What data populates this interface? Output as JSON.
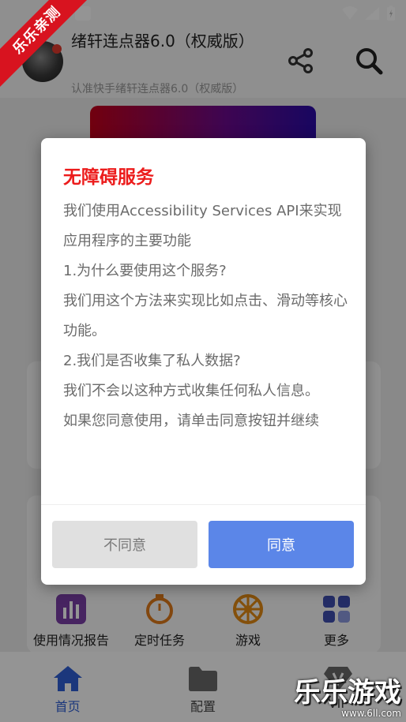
{
  "header": {
    "title": "绪轩连点器6.0（权威版）",
    "subtitle": "认准快手绪轩连点器6.0（权威版）"
  },
  "shortcuts": [
    {
      "label": "使用情况报告",
      "icon": "bar-chart-icon",
      "color": "#7b3fa8"
    },
    {
      "label": "定时任务",
      "icon": "stopwatch-icon",
      "color": "#e07a1a"
    },
    {
      "label": "游戏",
      "icon": "wheel-icon",
      "color": "#e38a14"
    },
    {
      "label": "更多",
      "icon": "grid-icon",
      "color": "#3e4fb0"
    }
  ],
  "bottom_nav": [
    {
      "label": "首页",
      "icon": "home-icon",
      "active": true
    },
    {
      "label": "配置",
      "icon": "folder-icon",
      "active": false
    },
    {
      "label": "VIP",
      "icon": "vip-diamond-icon",
      "active": false
    }
  ],
  "dialog": {
    "title": "无障碍服务",
    "paragraphs": [
      "我们使用Accessibility Services API来实现应用程序的主要功能",
      "1.为什么要使用这个服务?",
      "我们用这个方法来实现比如点击、滑动等核心功能。",
      "2.我们是否收集了私人数据?",
      "我们不会以这种方式收集任何私人信息。",
      "如果您同意使用，请单击同意按钮并继续"
    ],
    "disagree_label": "不同意",
    "agree_label": "同意"
  },
  "watermark": {
    "ribbon": "乐乐亲测",
    "brand": "乐乐游戏",
    "url": "www.6ll.com"
  },
  "colors": {
    "accent": "#5b86e8",
    "title_red": "#ec1c1c",
    "nav_active": "#2f5fd6"
  }
}
